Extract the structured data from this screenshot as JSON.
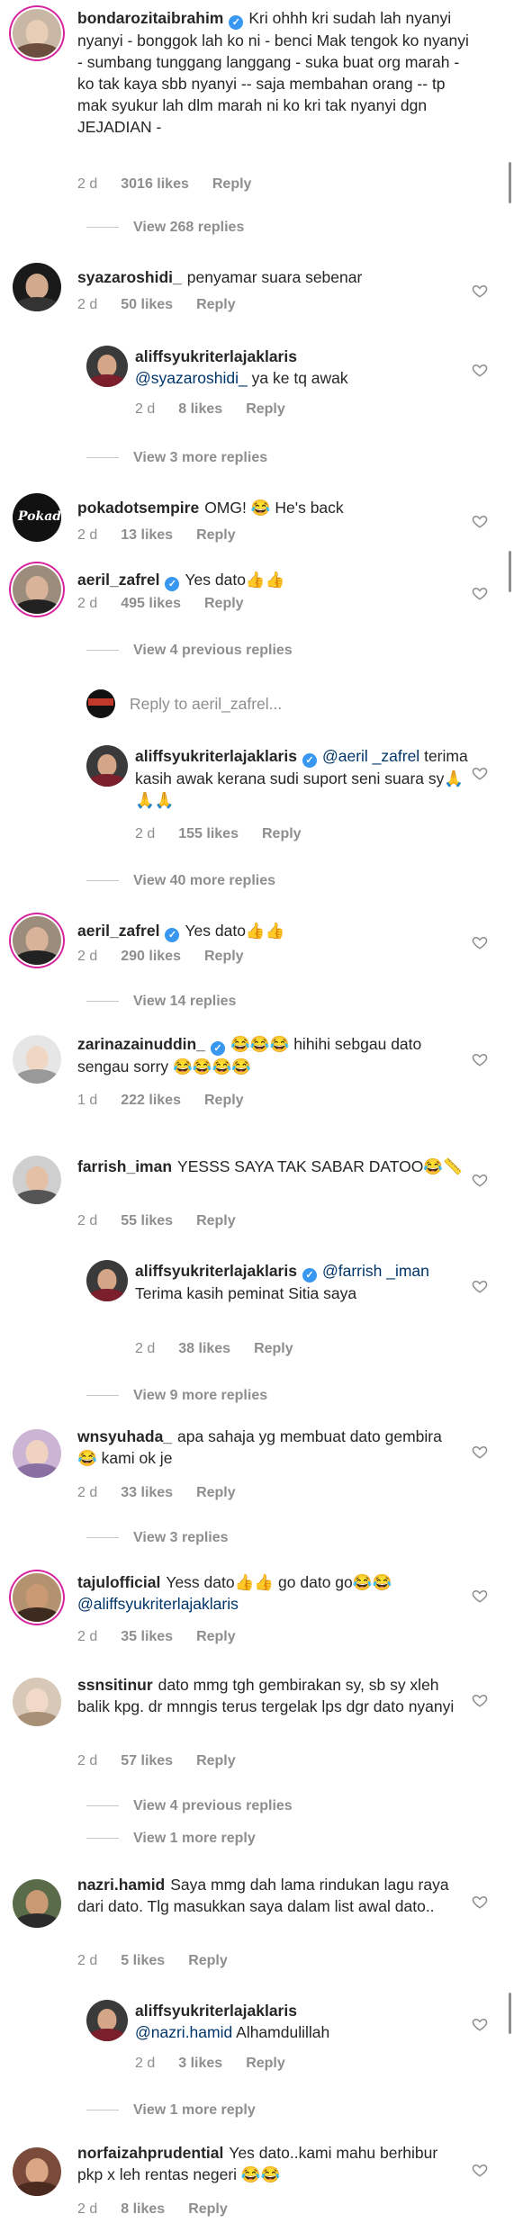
{
  "colors": {
    "accent": "#3897f0",
    "muted": "#8e8e8e",
    "text": "#262626",
    "mention": "#003569"
  },
  "comments": [
    {
      "user": "bondarozitaibrahim",
      "verified": true,
      "text": "Kri ohhh kri sudah lah nyanyi nyanyi - bonggok lah ko ni - benci Mak tengok ko nyanyi - sumbang tunggang langgang - suka buat org marah - ko tak kaya sbb nyanyi -- saja membahan orang -- tp mak syukur lah dlm marah ni ko kri tak nyanyi dgn JEJADIAN -",
      "time": "2 d",
      "likes": "3016 likes",
      "reply": "Reply",
      "thread": "View 268 replies"
    },
    {
      "user": "syazaroshidi_",
      "verified": false,
      "text": "penyamar suara sebenar",
      "time": "2 d",
      "likes": "50 likes",
      "reply": "Reply"
    },
    {
      "user": "aliffsyukriterlajaklaris",
      "verified": false,
      "mention": "@syazaroshidi_",
      "text": "ya ke tq awak",
      "time": "2 d",
      "likes": "8 likes",
      "reply": "Reply",
      "thread": "View 3 more replies"
    },
    {
      "user": "pokadotsempire",
      "verified": false,
      "text": "OMG! 😂 He's back",
      "time": "2 d",
      "likes": "13 likes",
      "reply": "Reply"
    },
    {
      "user": "aeril_zafrel",
      "verified": true,
      "text": "Yes dato👍👍",
      "time": "2 d",
      "likes": "495 likes",
      "reply": "Reply",
      "thread": "View 4 previous replies",
      "reply_to": "Reply to aeril_zafrel..."
    },
    {
      "user": "aliffsyukriterlajaklaris",
      "verified": true,
      "mention": "@aeril _zafrel",
      "text": "terima kasih awak kerana sudi suport seni suara sy🙏🙏🙏",
      "time": "2 d",
      "likes": "155 likes",
      "reply": "Reply",
      "thread": "View 40 more replies"
    },
    {
      "user": "aeril_zafrel",
      "verified": true,
      "text": "Yes dato👍👍",
      "time": "2 d",
      "likes": "290 likes",
      "reply": "Reply",
      "thread": "View 14 replies"
    },
    {
      "user": "zarinazainuddin_",
      "verified": true,
      "text": "😂😂😂 hihihi sebgau dato sengau sorry 😂😂😂😂",
      "time": "1 d",
      "likes": "222 likes",
      "reply": "Reply"
    },
    {
      "user": "farrish_iman",
      "verified": false,
      "text": "YESSS SAYA TAK SABAR DATOO😂📏",
      "time": "2 d",
      "likes": "55 likes",
      "reply": "Reply"
    },
    {
      "user": "aliffsyukriterlajaklaris",
      "verified": true,
      "mention": "@farrish _iman",
      "text": "Terima kasih peminat Sitia saya",
      "time": "2 d",
      "likes": "38 likes",
      "reply": "Reply",
      "thread": "View 9 more replies"
    },
    {
      "user": "wnsyuhada_",
      "verified": false,
      "text": "apa sahaja yg membuat dato gembira 😂 kami ok je",
      "time": "2 d",
      "likes": "33 likes",
      "reply": "Reply",
      "thread": "View 3 replies"
    },
    {
      "user": "tajulofficial",
      "verified": false,
      "text": "Yess dato👍👍 go dato go😂😂",
      "mention_after": "@aliffsyukriterlajaklaris",
      "time": "2 d",
      "likes": "35 likes",
      "reply": "Reply"
    },
    {
      "user": "ssnsitinur",
      "verified": false,
      "text": "dato mmg tgh gembirakan sy, sb sy xleh balik kpg. dr mnngis terus tergelak lps dgr dato nyanyi",
      "time": "2 d",
      "likes": "57 likes",
      "reply": "Reply",
      "thread": "View 4 previous replies",
      "thread2": "View 1 more reply"
    },
    {
      "user": "nazri.hamid",
      "verified": false,
      "text": "Saya mmg dah lama rindukan lagu raya dari dato. Tlg masukkan saya dalam list awal dato..",
      "time": "2 d",
      "likes": "5 likes",
      "reply": "Reply"
    },
    {
      "user": "aliffsyukriterlajaklaris",
      "verified": false,
      "mention": "@nazri.hamid",
      "text": "Alhamdulillah",
      "time": "2 d",
      "likes": "3 likes",
      "reply": "Reply",
      "thread": "View 1 more reply"
    },
    {
      "user": "norfaizahprudential",
      "verified": false,
      "text": "Yes dato..kami mahu berhibur pkp x leh rentas negeri 😂😂",
      "time": "2 d",
      "likes": "8 likes",
      "reply": "Reply"
    }
  ]
}
